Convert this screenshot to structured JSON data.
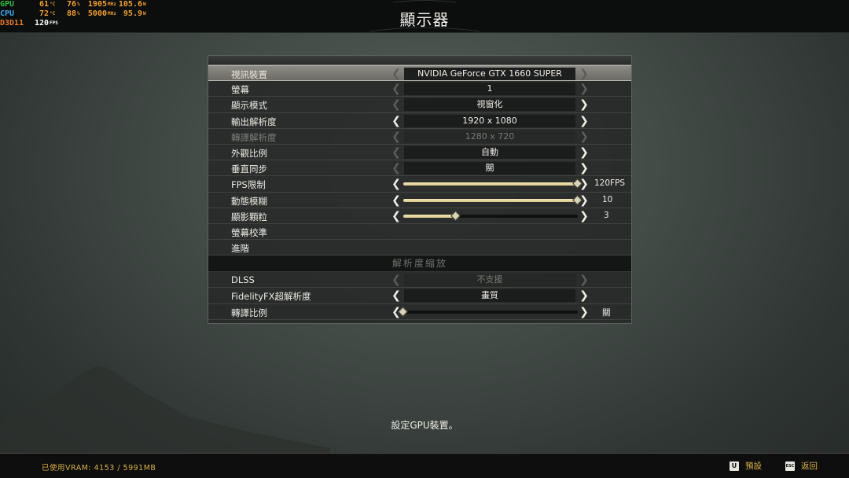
{
  "osd": {
    "gpu": {
      "tag": "GPU",
      "temp": "61",
      "temp_unit": "°C",
      "usage": "76",
      "usage_unit": "%",
      "clock": "1905",
      "clock_unit": "MHz",
      "power": "105.6",
      "power_unit": "W"
    },
    "cpu": {
      "tag": "CPU",
      "temp": "72",
      "temp_unit": "°C",
      "usage": "88",
      "usage_unit": "%",
      "clock": "5000",
      "clock_unit": "MHz",
      "power": "95.9",
      "power_unit": "W"
    },
    "d3d": {
      "tag": "D3D11",
      "fps": "120",
      "fps_unit": "FPS"
    }
  },
  "header": {
    "title": "顯示器"
  },
  "settings": [
    {
      "label": "視訊裝置",
      "value": "NVIDIA GeForce GTX 1660 SUPER"
    },
    {
      "label": "螢幕",
      "value": "1"
    },
    {
      "label": "顯示模式",
      "value": "視窗化"
    },
    {
      "label": "輸出解析度",
      "value": "1920 x 1080"
    },
    {
      "label": "轉譯解析度",
      "value": "1280 x 720"
    },
    {
      "label": "外觀比例",
      "value": "自動"
    },
    {
      "label": "垂直同步",
      "value": "關"
    },
    {
      "label": "FPS限制",
      "value": "120FPS",
      "level": 1.0
    },
    {
      "label": "動態模糊",
      "value": "10",
      "level": 1.0
    },
    {
      "label": "顯影顆粒",
      "value": "3",
      "level": 0.3
    },
    {
      "label": "螢幕校準"
    },
    {
      "label": "進階"
    }
  ],
  "section_title": "解析度縮放",
  "scaling": [
    {
      "label": "DLSS",
      "value": "不支援"
    },
    {
      "label": "FidelityFX超解析度",
      "value": "畫質"
    },
    {
      "label": "轉譯比例",
      "value": "關",
      "level": 0.0
    }
  ],
  "description": "設定GPU裝置。",
  "footer": {
    "vram": "已使用VRAM: 4153 / 5991MB",
    "default_key": "U",
    "default_label": "預設",
    "back_key": "ESC",
    "back_label": "返回"
  },
  "colors": {
    "accent": "#d9b04a",
    "slider": "#e8dca8",
    "selected_row": "#7e7d76"
  }
}
